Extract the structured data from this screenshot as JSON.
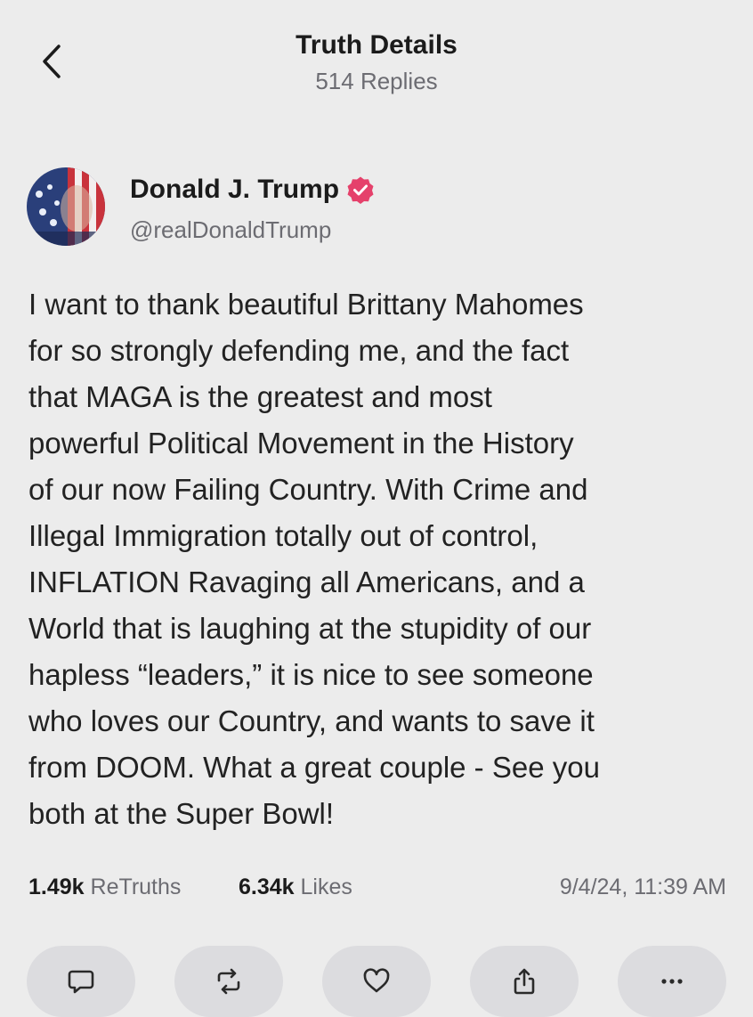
{
  "header": {
    "title": "Truth Details",
    "replies": "514 Replies"
  },
  "author": {
    "name": "Donald J. Trump",
    "handle": "@realDonaldTrump",
    "verified_color": "#e5416b"
  },
  "post": {
    "lines": [
      "I want to thank beautiful Brittany Mahomes",
      "for so strongly defending me, and the fact",
      "that MAGA is the greatest and most",
      "powerful Political Movement in the History",
      "of our now Failing Country. With Crime and",
      "Illegal Immigration totally out of control,",
      "INFLATION Ravaging all Americans, and a",
      "World that is laughing at the stupidity of our",
      "hapless “leaders,” it is nice to see someone",
      "who loves our Country, and wants to save it",
      "from DOOM. What a great couple - See you",
      "both at the Super Bowl!"
    ]
  },
  "stats": {
    "retruths_count": "1.49k",
    "retruths_label": "ReTruths",
    "likes_count": "6.34k",
    "likes_label": "Likes",
    "timestamp": "9/4/24, 11:39 AM"
  },
  "actions": [
    {
      "icon": "reply-icon"
    },
    {
      "icon": "retruth-icon"
    },
    {
      "icon": "heart-icon"
    },
    {
      "icon": "share-icon"
    },
    {
      "icon": "more-icon"
    }
  ]
}
